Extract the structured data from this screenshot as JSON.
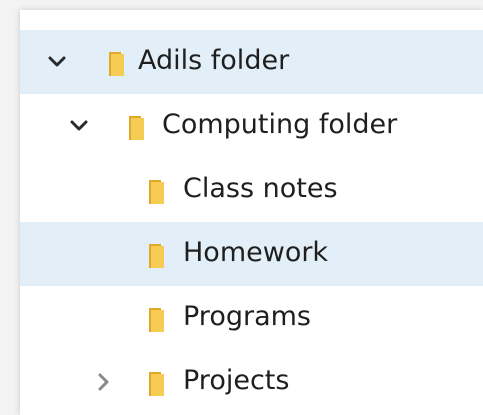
{
  "tree": {
    "items": [
      {
        "label": "Adils folder",
        "expanded": true,
        "has_children": true,
        "selected": true
      },
      {
        "label": "Computing folder",
        "expanded": true,
        "has_children": true,
        "selected": false
      },
      {
        "label": "Class notes",
        "has_children": false,
        "selected": false
      },
      {
        "label": "Homework",
        "has_children": false,
        "selected": true
      },
      {
        "label": "Programs",
        "has_children": false,
        "selected": false
      },
      {
        "label": "Projects",
        "expanded": false,
        "has_children": true,
        "selected": false
      }
    ]
  },
  "colors": {
    "selection": "#e3eff8",
    "folder": "#f5c84a",
    "chevron_expanded": "#2b2b2b",
    "chevron_collapsed": "#8a8a8a"
  }
}
